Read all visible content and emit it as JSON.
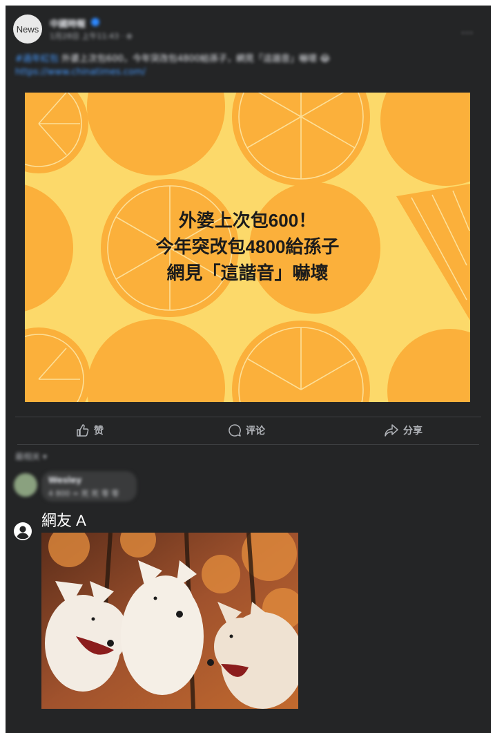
{
  "post": {
    "avatar_label": "News",
    "page_name": "中國時報",
    "timestamp": "1月28日 上午11:43 · ⊕",
    "more": "···",
    "text": "外婆上次包600，今年突改包4800給孫子，網見「這諧音」嚇壞 😂",
    "hashtag": "#過年紅包",
    "link_text": "https://www.chinatimes.com/",
    "image": {
      "headline_lines": [
        "外婆上次包600！",
        "今年突改包4800給孫子",
        "網見「這諧音」嚇壞"
      ]
    }
  },
  "actions": {
    "like_label": "赞",
    "comment_label": "评论",
    "share_label": "分享"
  },
  "comments": {
    "sort_label": "最相关 ▾",
    "previous": {
      "name": "Wesley",
      "text": "4 800 = 死 死 零 零"
    },
    "new_comment": {
      "author": "網友 A",
      "image_icon": "laughing-wolves-image"
    }
  },
  "colors": {
    "card_bg": "#242526",
    "banner_bg": "#fcd96a",
    "orange": "#fbb03b",
    "link": "#4599ff"
  }
}
